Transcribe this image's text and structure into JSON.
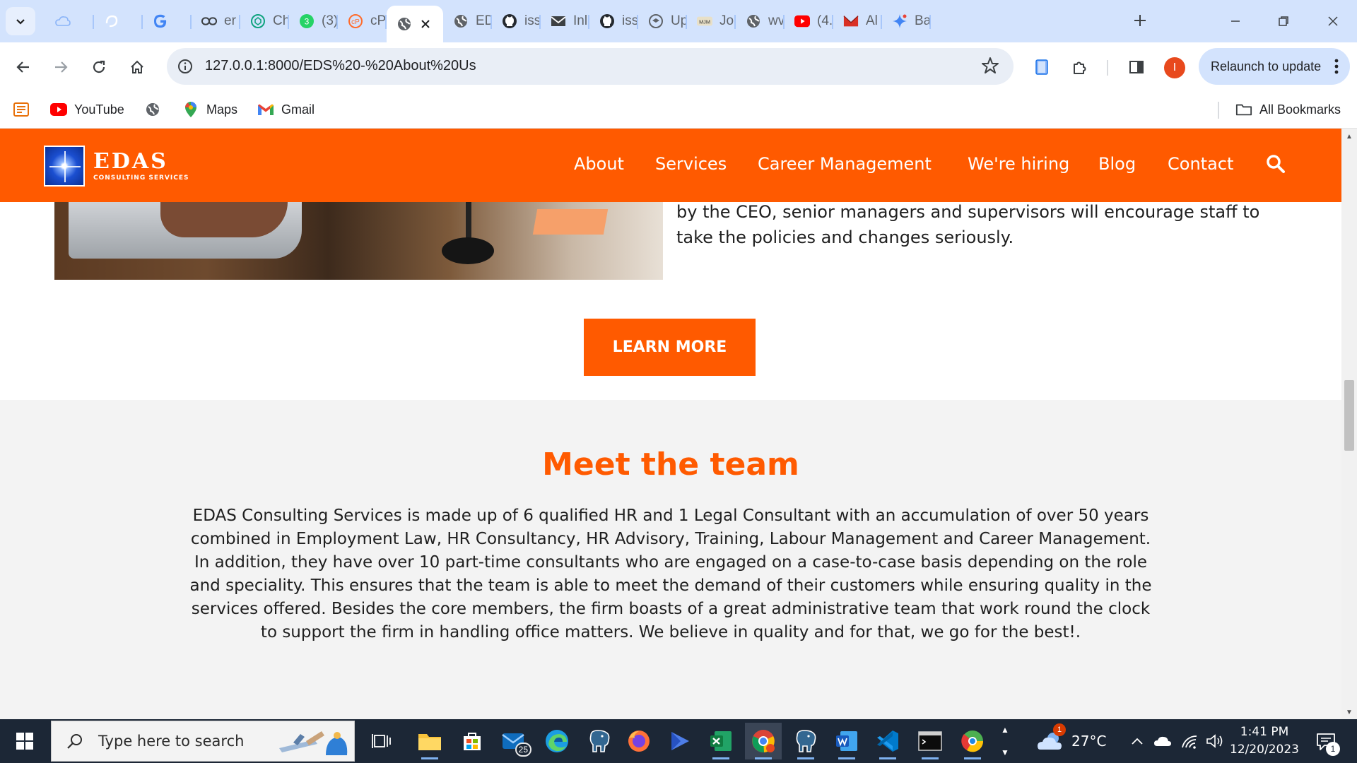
{
  "browser": {
    "tabs": [
      {
        "title": "",
        "icon": "cloud-icon"
      },
      {
        "title": "",
        "icon": "swirl-icon"
      },
      {
        "title": "",
        "icon": "google-icon"
      },
      {
        "title": "er",
        "icon": "link-icon"
      },
      {
        "title": "Ch",
        "icon": "chatgpt-icon"
      },
      {
        "title": "(3)",
        "icon": "whatsapp-icon"
      },
      {
        "title": "cP",
        "icon": "cpanel-icon"
      },
      {
        "title": "",
        "icon": "globe-icon",
        "active": true
      },
      {
        "title": "ED",
        "icon": "globe-icon"
      },
      {
        "title": "iss",
        "icon": "github-icon"
      },
      {
        "title": "Inl",
        "icon": "mail-icon"
      },
      {
        "title": "iss",
        "icon": "github-icon"
      },
      {
        "title": "Up",
        "icon": "upwork-icon"
      },
      {
        "title": "Jol",
        "icon": "jobs-icon"
      },
      {
        "title": "wv",
        "icon": "globe-icon"
      },
      {
        "title": "(4.",
        "icon": "youtube-icon"
      },
      {
        "title": "Al",
        "icon": "envelope-icon"
      },
      {
        "title": "Ba",
        "icon": "bard-icon"
      }
    ],
    "address": "127.0.0.1:8000/EDS%20-%20About%20Us",
    "profile_initial": "I",
    "relaunch_label": "Relaunch to update",
    "bookmarks": [
      {
        "label": "",
        "icon": "apps-icon"
      },
      {
        "label": "YouTube",
        "icon": "youtube-icon"
      },
      {
        "label": "",
        "icon": "globe-icon"
      },
      {
        "label": "Maps",
        "icon": "maps-icon"
      },
      {
        "label": "Gmail",
        "icon": "gmail-icon"
      }
    ],
    "all_bookmarks_label": "All Bookmarks"
  },
  "site": {
    "logo": {
      "name": "EDAS",
      "tagline": "CONSULTING SERVICES"
    },
    "nav": [
      "About",
      "Services",
      "Career Management",
      "We're hiring",
      "Blog",
      "Contact"
    ],
    "hero_text": "by the CEO, senior managers and supervisors will encourage staff to take the policies and changes seriously.",
    "learn_more": "LEARN MORE",
    "team": {
      "title": "Meet the team",
      "body": "EDAS Consulting Services is made up of 6 qualified HR and 1 Legal Consultant with an accumulation of over 50 years combined in Employment Law, HR Consultancy, HR Advisory, Training, Labour Management and Career Management. In addition, they have over 10 part-time consultants who are engaged on a case-to-case basis depending on the role and speciality. This ensures that the team is able to meet the demand of their customers while ensuring quality in the services offered. Besides the core members, the firm boasts of a great administrative team that work round the clock to support the firm in handling office matters. We believe in quality and for that, we go for the best!."
    },
    "colors": {
      "brand": "#ff5a00",
      "team_bg": "#f3f3f3"
    }
  },
  "taskbar": {
    "search_placeholder": "Type here to search",
    "mail_badge": "25",
    "weather": {
      "temp": "27°C",
      "badge": "1"
    },
    "time": "1:41 PM",
    "date": "12/20/2023",
    "notification_count": "1"
  }
}
